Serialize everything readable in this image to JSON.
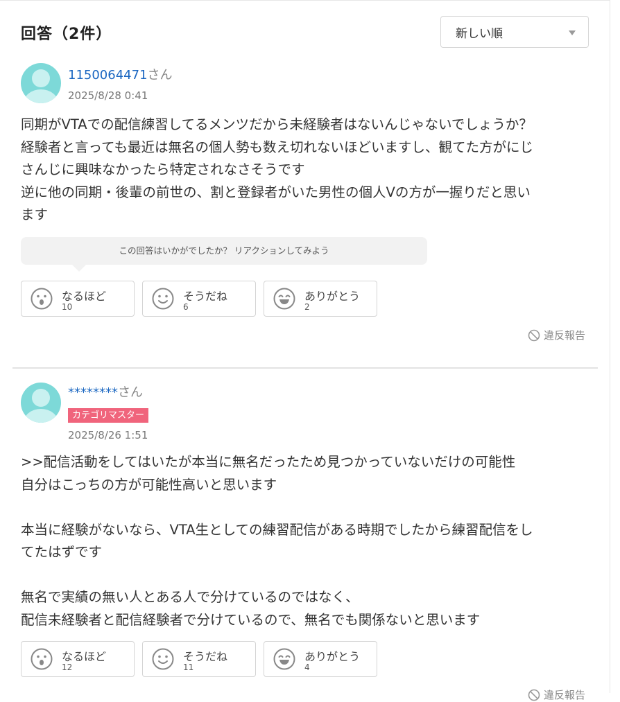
{
  "header": {
    "title": "回答（2件）",
    "sort_label": "新しい順"
  },
  "answers": [
    {
      "user": "1150064471",
      "honorific": "さん",
      "badge": "",
      "date": "2025/8/28 0:41",
      "lines": [
        "同期がVTAでの配信練習してるメンツだから未経験者はないんじゃないでしょうか？",
        "経験者と言っても最近は無名の個人勢も数え切れないほどいますし、観てた方がにじ",
        "さんじに興味なかったら特定されなさそうです",
        "逆に他の同期・後輩の前世の、割と登録者がいた男性の個人Vの方が一握りだと思い",
        "ます"
      ],
      "prompt": "この回答はいかがでしたか？ リアクションしてみよう",
      "reactions": [
        {
          "label": "なるほど",
          "count": "10",
          "icon": "surprised-face-icon"
        },
        {
          "label": "そうだね",
          "count": "6",
          "icon": "smile-face-icon"
        },
        {
          "label": "ありがとう",
          "count": "2",
          "icon": "happy-face-icon"
        }
      ],
      "report": "違反報告"
    },
    {
      "user": "********",
      "honorific": "さん",
      "badge": "カテゴリマスター",
      "date": "2025/8/26 1:51",
      "lines": [
        ">>配信活動をしてはいたが本当に無名だったため見つかっていないだけの可能性",
        "自分はこっちの方が可能性高いと思います",
        "",
        "本当に経験がないなら、VTA生としての練習配信がある時期でしたから練習配信をし",
        "てたはずです",
        "",
        "無名で実績の無い人とある人で分けているのではなく、",
        "配信未経験者と配信経験者で分けているので、無名でも関係ないと思います"
      ],
      "reactions": [
        {
          "label": "なるほど",
          "count": "12",
          "icon": "surprised-face-icon"
        },
        {
          "label": "そうだね",
          "count": "11",
          "icon": "smile-face-icon"
        },
        {
          "label": "ありがとう",
          "count": "4",
          "icon": "happy-face-icon"
        }
      ],
      "report": "違反報告"
    }
  ]
}
